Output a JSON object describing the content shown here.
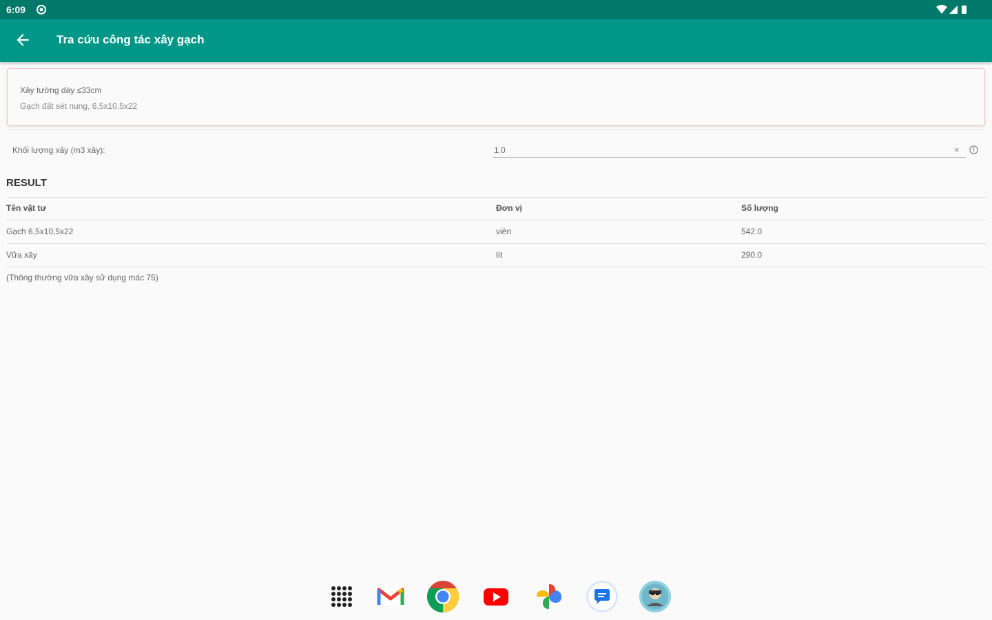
{
  "status_bar": {
    "time": "6:09"
  },
  "app_bar": {
    "title": "Tra cứu công tác xây gạch"
  },
  "card": {
    "line1": "Xây tường dày ≤33cm",
    "line2": "Gạch đất sét nung, 6,5x10,5x22"
  },
  "input": {
    "label": "Khối lượng xây (m3 xây):",
    "value": "1.0"
  },
  "result": {
    "heading": "RESULT",
    "columns": [
      "Tên vật tư",
      "Đơn vị",
      "Số lượng"
    ],
    "rows": [
      [
        "Gạch 6,5x10,5x22",
        "viên",
        "542.0"
      ],
      [
        "Vữa xây",
        "lít",
        "290.0"
      ]
    ],
    "note": "(Thông thường vữa xây sử dụng mác 75)"
  },
  "dock": {
    "apps": [
      "app-drawer",
      "gmail",
      "chrome",
      "youtube",
      "photos",
      "messages",
      "profile"
    ]
  }
}
